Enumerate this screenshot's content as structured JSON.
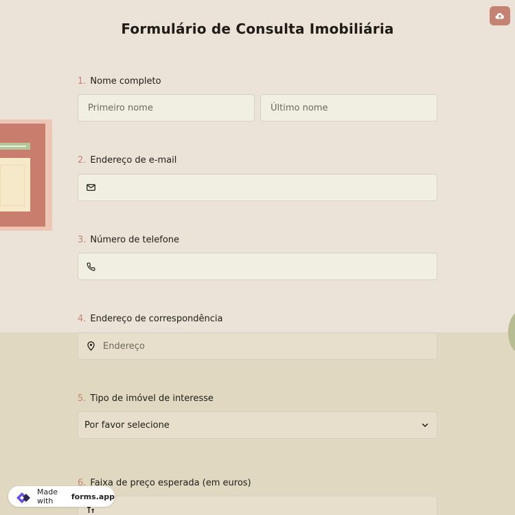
{
  "form": {
    "title": "Formulário de Consulta Imobiliária"
  },
  "questions": [
    {
      "number": "1.",
      "label": "Nome completo",
      "fields": [
        {
          "placeholder": "Primeiro nome"
        },
        {
          "placeholder": "Último nome"
        }
      ]
    },
    {
      "number": "2.",
      "label": "Endereço de e-mail",
      "icon": "envelope-icon"
    },
    {
      "number": "3.",
      "label": "Número de telefone",
      "icon": "phone-icon"
    },
    {
      "number": "4.",
      "label": "Endereço de correspondência",
      "icon": "location-pin-icon",
      "placeholder": "Endereço"
    },
    {
      "number": "5.",
      "label": "Tipo de imóvel de interesse",
      "selected": "Por favor selecione",
      "icon": "chevron-down-icon"
    },
    {
      "number": "6.",
      "label": "Faixa de preço esperada (em euros)",
      "icon": "text-cursor-icon"
    }
  ],
  "toolbar": {
    "upload_icon": "cloud-upload-icon"
  },
  "badge": {
    "prefix": "Made with",
    "brand": "forms.app",
    "icon": "forms-app-logo-icon"
  },
  "colors": {
    "accent": "#c48272",
    "background_top": "#ebe3d8",
    "background_bottom": "#e0d8c0",
    "field_border": "#d6cfbf"
  }
}
